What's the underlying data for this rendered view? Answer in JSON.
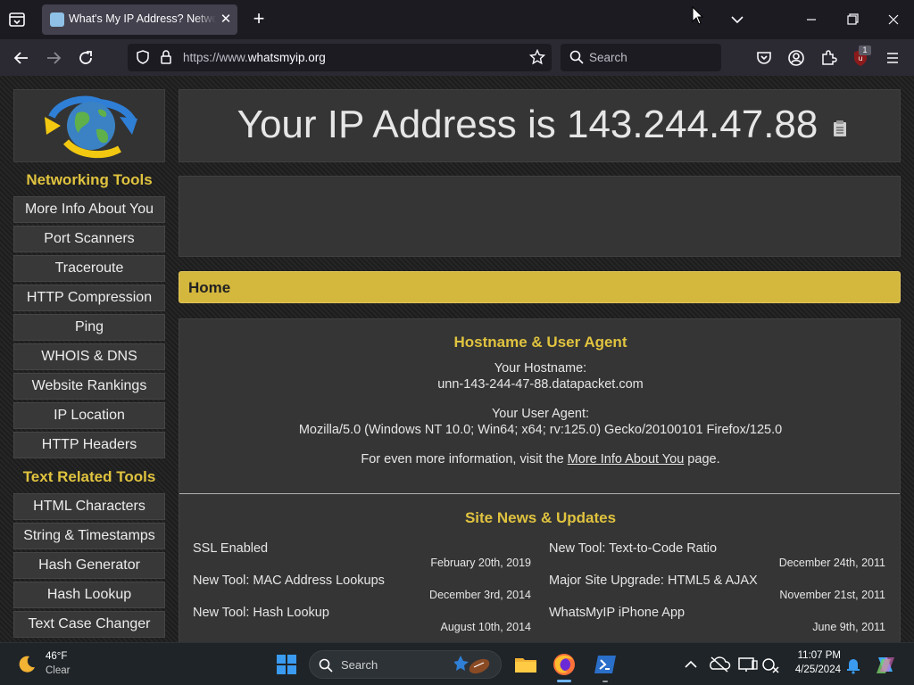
{
  "browser": {
    "tab_title": "What's My IP Address? Network",
    "url_prefix": "https://www.",
    "url_domain": "whatsmyip.org",
    "search_placeholder": "Search",
    "extension_badge": "1"
  },
  "sidebar": {
    "networking_heading": "Networking Tools",
    "networking_items": [
      "More Info About You",
      "Port Scanners",
      "Traceroute",
      "HTTP Compression",
      "Ping",
      "WHOIS & DNS",
      "Website Rankings",
      "IP Location",
      "HTTP Headers"
    ],
    "text_heading": "Text Related Tools",
    "text_items": [
      "HTML Characters",
      "String & Timestamps",
      "Hash Generator",
      "Hash Lookup",
      "Text Case Changer"
    ]
  },
  "main": {
    "ip_text": "Your IP Address is 143.244.47.88",
    "home_label": "Home",
    "hostname_heading": "Hostname & User Agent",
    "hostname_label": "Your Hostname:",
    "hostname_value": "unn-143-244-47-88.datapacket.com",
    "useragent_label": "Your User Agent:",
    "useragent_value": "Mozilla/5.0 (Windows NT 10.0; Win64; x64; rv:125.0) Gecko/20100101 Firefox/125.0",
    "more_info_prefix": "For even more information, visit the ",
    "more_info_link": "More Info About You",
    "more_info_suffix": " page.",
    "news_heading": "Site News & Updates",
    "news_left": [
      {
        "title": "SSL Enabled",
        "date": "February 20th, 2019"
      },
      {
        "title": "New Tool: MAC Address Lookups",
        "date": "December 3rd, 2014"
      },
      {
        "title": "New Tool: Hash Lookup",
        "date": "August 10th, 2014"
      }
    ],
    "news_right": [
      {
        "title": "New Tool: Text-to-Code Ratio",
        "date": "December 24th, 2011"
      },
      {
        "title": "Major Site Upgrade: HTML5 & AJAX",
        "date": "November 21st, 2011"
      },
      {
        "title": "WhatsMyIP iPhone App",
        "date": "June 9th, 2011"
      }
    ]
  },
  "taskbar": {
    "temperature": "46°F",
    "condition": "Clear",
    "search_placeholder": "Search",
    "time": "11:07 PM",
    "date": "4/25/2024"
  },
  "colors": {
    "accent_gold": "#e0c33f",
    "home_bar": "#d4b73d",
    "panel": "#353535"
  }
}
